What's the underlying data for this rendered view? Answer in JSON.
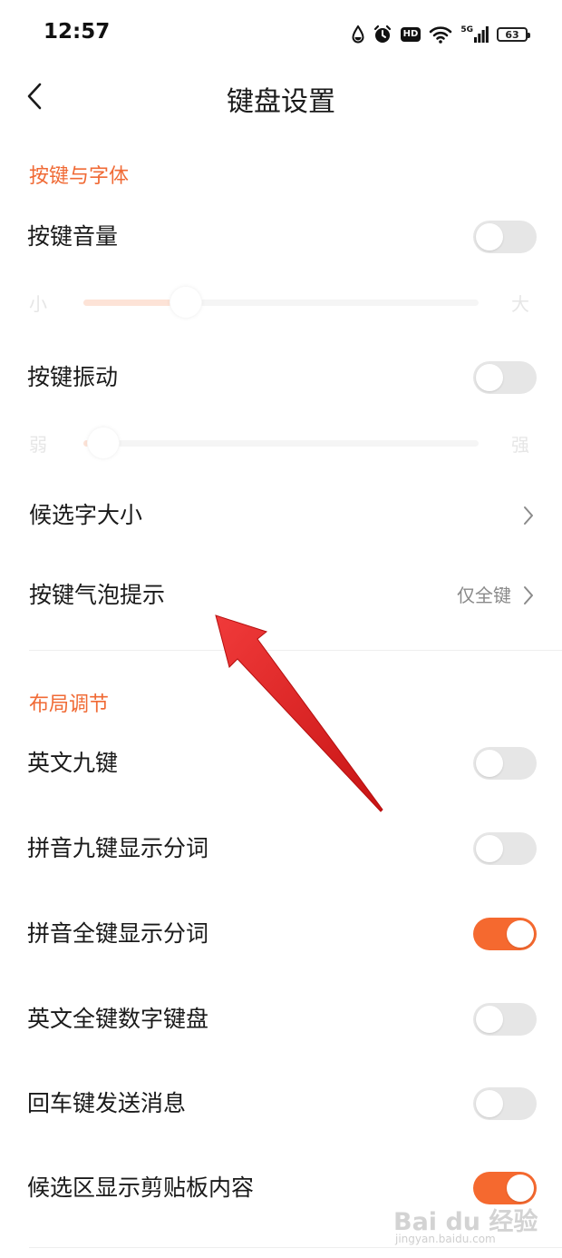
{
  "status_bar": {
    "time": "12:57",
    "hd_label": "HD",
    "signal_label": "5G",
    "battery_level": "63"
  },
  "header": {
    "title": "键盘设置"
  },
  "sections": {
    "keys_and_font": {
      "title": "按键与字体",
      "key_volume": {
        "label": "按键音量",
        "enabled": false
      },
      "volume_slider": {
        "min_label": "小",
        "max_label": "大",
        "value": 0.26
      },
      "key_vibration": {
        "label": "按键振动",
        "enabled": false
      },
      "vibration_slider": {
        "min_label": "弱",
        "max_label": "强",
        "value": 0.05
      },
      "candidate_size": {
        "label": "候选字大小"
      },
      "key_bubble": {
        "label": "按键气泡提示",
        "value": "仅全键"
      }
    },
    "layout": {
      "title": "布局调节",
      "items": [
        {
          "label": "英文九键",
          "enabled": false
        },
        {
          "label": "拼音九键显示分词",
          "enabled": false
        },
        {
          "label": "拼音全键显示分词",
          "enabled": true
        },
        {
          "label": "英文全键数字键盘",
          "enabled": false
        },
        {
          "label": "回车键发送消息",
          "enabled": false
        },
        {
          "label": "候选区显示剪贴板内容",
          "enabled": true
        }
      ]
    }
  },
  "watermark": {
    "brand": "Bai du 经验",
    "url": "jingyan.baidu.com"
  },
  "colors": {
    "accent": "#f5692f",
    "section_title": "#f06a35",
    "toggle_off": "#e6e6e6"
  }
}
